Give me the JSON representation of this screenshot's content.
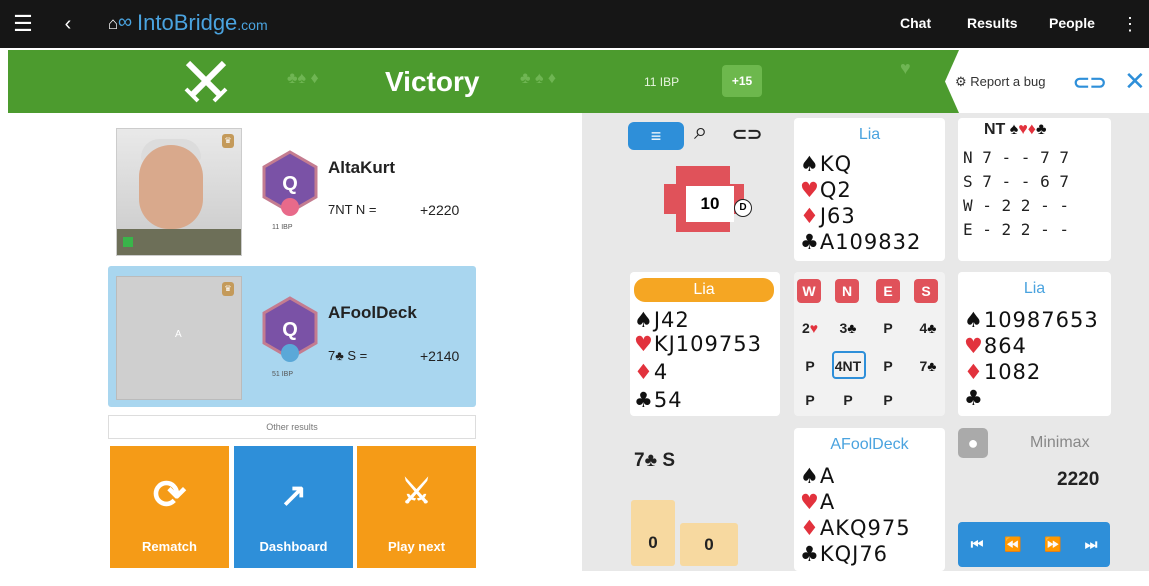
{
  "topbar": {
    "menu_icon": "hamburger-icon",
    "back_icon": "chevron-left-icon",
    "home_icon": "home-icon",
    "logo_icon": "infinity-logo-icon",
    "brand_text": "IntoBridge",
    "brand_suffix": ".com",
    "links": [
      "Chat",
      "Results",
      "People"
    ],
    "more_icon": "kebab-icon"
  },
  "banner": {
    "title": "Victory",
    "ibp": "11 IBP",
    "plus": "+15",
    "report": "Report a bug",
    "link_icon": "link-icon",
    "close_icon": "close-icon",
    "color": "#4c9b2e"
  },
  "players": [
    {
      "name": "AltaKurt",
      "contract": "7NT N =",
      "score": "+2220",
      "ibp": "11 IBP",
      "badge_letter": "Q"
    },
    {
      "name": "AFoolDeck",
      "contract": "7♣ S =",
      "score": "+2140",
      "ibp": "51 IBP",
      "badge_letter": "Q",
      "photo_letter": "A"
    }
  ],
  "other_results": "Other results",
  "actions": [
    {
      "label": "Rematch",
      "icon": "rematch-icon",
      "color": "#f59b17"
    },
    {
      "label": "Dashboard",
      "icon": "chart-icon",
      "color": "#2e8fd9"
    },
    {
      "label": "Play next",
      "icon": "swords-icon",
      "color": "#f59b17"
    }
  ],
  "board": {
    "number": "10",
    "dealer": "D",
    "toolbar_icons": [
      "menu-icon",
      "search-icon",
      "link-icon"
    ],
    "north": {
      "name": "Lia",
      "spades": "KQ",
      "hearts": "Q2",
      "diamonds": "J63",
      "clubs": "A109832"
    },
    "west": {
      "name": "Lia",
      "spades": "J42",
      "hearts": "KJ109753",
      "diamonds": "4",
      "clubs": "54"
    },
    "east": {
      "name": "Lia",
      "spades": "10987653",
      "hearts": "864",
      "diamonds": "1082",
      "clubs": ""
    },
    "south": {
      "name": "AFoolDeck",
      "spades": "A",
      "hearts": "A",
      "diamonds": "AKQ975",
      "clubs": "KQJ76"
    },
    "makeable": {
      "header": "NT",
      "rows": [
        [
          "N",
          "7",
          "-",
          "-",
          "7",
          "7"
        ],
        [
          "S",
          "7",
          "-",
          "-",
          "6",
          "7"
        ],
        [
          "W",
          "-",
          "2",
          "2",
          "-",
          "-"
        ],
        [
          "E",
          "-",
          "2",
          "2",
          "-",
          "-"
        ]
      ]
    },
    "bidding": {
      "headers": [
        "W",
        "N",
        "E",
        "S"
      ],
      "rows": [
        [
          "2♥",
          "3♣",
          "P",
          "4♣"
        ],
        [
          "P",
          "4NT",
          "P",
          "7♣"
        ],
        [
          "P",
          "P",
          "P",
          ""
        ]
      ]
    },
    "contract": "7♣ S",
    "tricks": [
      "0",
      "0"
    ],
    "minimax": {
      "label": "Minimax",
      "score": "2220",
      "icon": "bulb-icon"
    },
    "nav_icons": [
      "first-icon",
      "rewind-icon",
      "forward-icon",
      "last-icon"
    ]
  }
}
